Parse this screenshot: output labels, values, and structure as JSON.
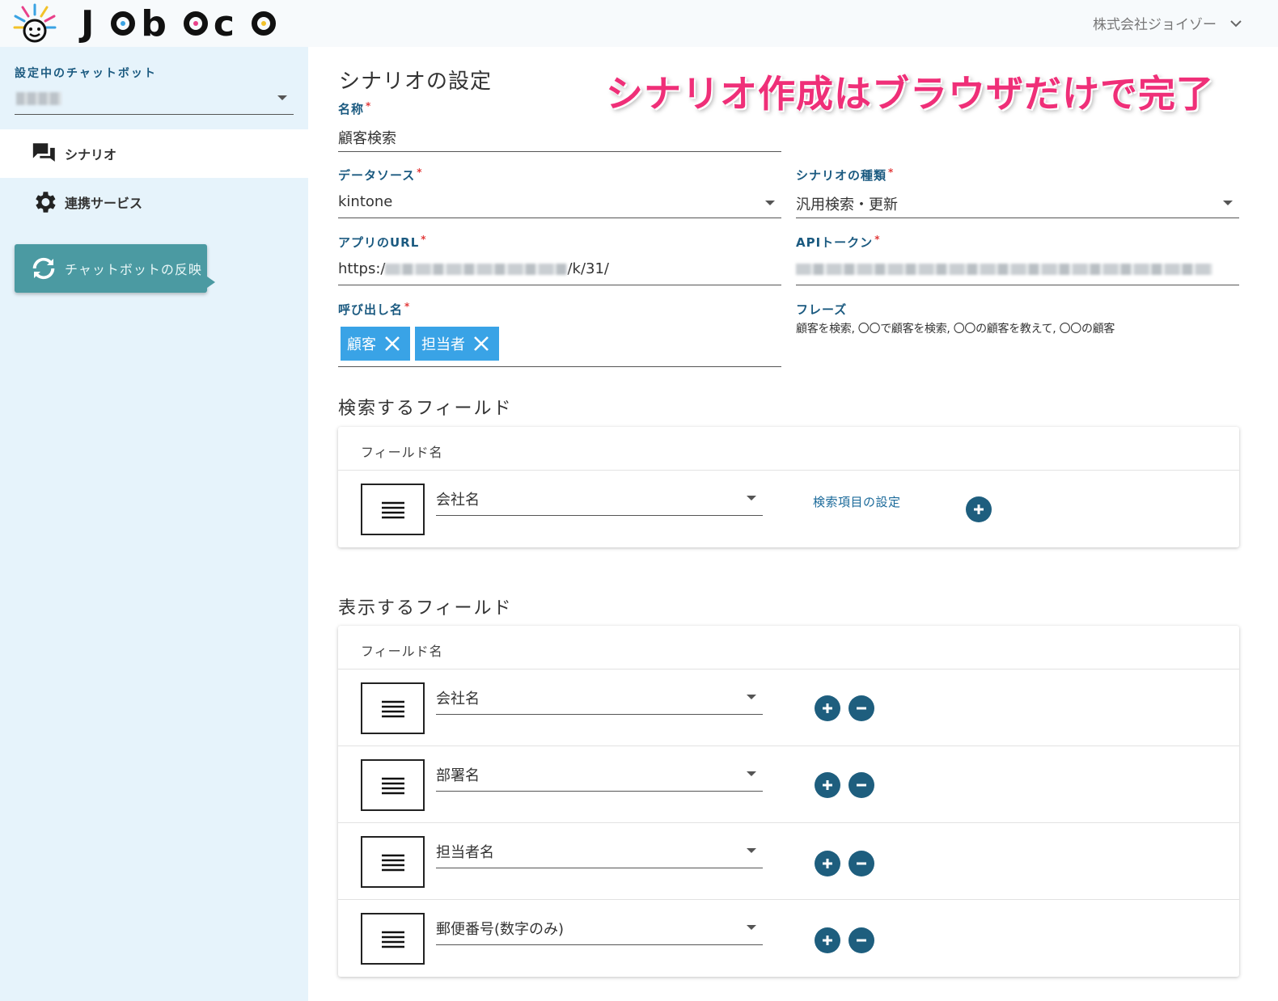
{
  "brand": {
    "name": "Joboco"
  },
  "header": {
    "account": "株式会社ジョイゾー"
  },
  "sidebar": {
    "bot_label": "設定中のチャットボット",
    "nav": [
      {
        "label": "シナリオ",
        "icon": "chat-bubbles-icon"
      },
      {
        "label": "連携サービス",
        "icon": "gear-icon"
      }
    ],
    "reflect_label": "チャットボットの反映"
  },
  "main": {
    "title": "シナリオの設定",
    "banner": "シナリオ作成はブラウザだけで完了",
    "fields": {
      "name": {
        "label": "名称",
        "value": "顧客検索"
      },
      "datasource": {
        "label": "データソース",
        "value": "kintone"
      },
      "scenario_type": {
        "label": "シナリオの種類",
        "value": "汎用検索・更新"
      },
      "app_url": {
        "label": "アプリのURL",
        "value_prefix": "https:/",
        "value_suffix": "/k/31/"
      },
      "api_token": {
        "label": "APIトークン"
      },
      "call_name": {
        "label": "呼び出し名",
        "chips": [
          "顧客",
          "担当者"
        ]
      },
      "phrase": {
        "label": "フレーズ",
        "value": "顧客を検索, 〇〇で顧客を検索, 〇〇の顧客を教えて, 〇〇の顧客"
      }
    },
    "search_section": {
      "title": "検索するフィールド",
      "column_header": "フィールド名",
      "rows": [
        {
          "value": "会社名",
          "link": "検索項目の設定"
        }
      ]
    },
    "display_section": {
      "title": "表示するフィールド",
      "column_header": "フィールド名",
      "rows": [
        {
          "value": "会社名"
        },
        {
          "value": "部署名"
        },
        {
          "value": "担当者名"
        },
        {
          "value": "郵便番号(数字のみ)"
        }
      ]
    }
  },
  "colors": {
    "accent": "#1b5a80",
    "chip": "#39a3e6",
    "reflect_button": "#4b9aa2",
    "banner": "#ef2f78",
    "sidebar_bg": "#e6f3fb"
  }
}
